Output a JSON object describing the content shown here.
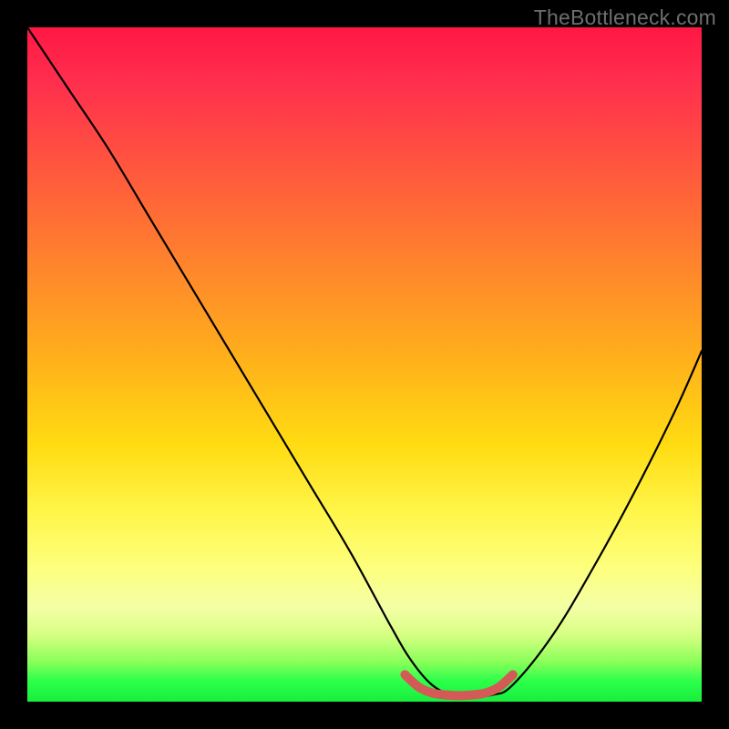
{
  "watermark": "TheBottleneck.com",
  "chart_data": {
    "type": "line",
    "title": "",
    "xlabel": "",
    "ylabel": "",
    "xlim": [
      0,
      100
    ],
    "ylim": [
      0,
      100
    ],
    "grid": false,
    "series": [
      {
        "name": "curve",
        "color": "#000000",
        "x": [
          0,
          6,
          12,
          18,
          24,
          30,
          36,
          42,
          48,
          54,
          57,
          60,
          63,
          66,
          69,
          72,
          78,
          84,
          90,
          96,
          100
        ],
        "y": [
          100,
          91,
          82,
          72,
          62,
          52,
          42,
          32,
          22,
          11,
          6,
          2.5,
          1.0,
          0.8,
          1.0,
          2.5,
          10,
          20,
          31,
          43,
          52
        ]
      },
      {
        "name": "highlight-band",
        "color": "#d9534f",
        "x": [
          56,
          58,
          60,
          62,
          64,
          66,
          68,
          70,
          72
        ],
        "y": [
          4.0,
          2.2,
          1.3,
          1.0,
          0.9,
          1.0,
          1.3,
          2.2,
          4.0
        ]
      }
    ],
    "annotations": []
  },
  "colors": {
    "curve": "#000000",
    "highlight": "#d35a56",
    "background_top": "#ff1744",
    "background_bottom": "#17ef3d"
  }
}
